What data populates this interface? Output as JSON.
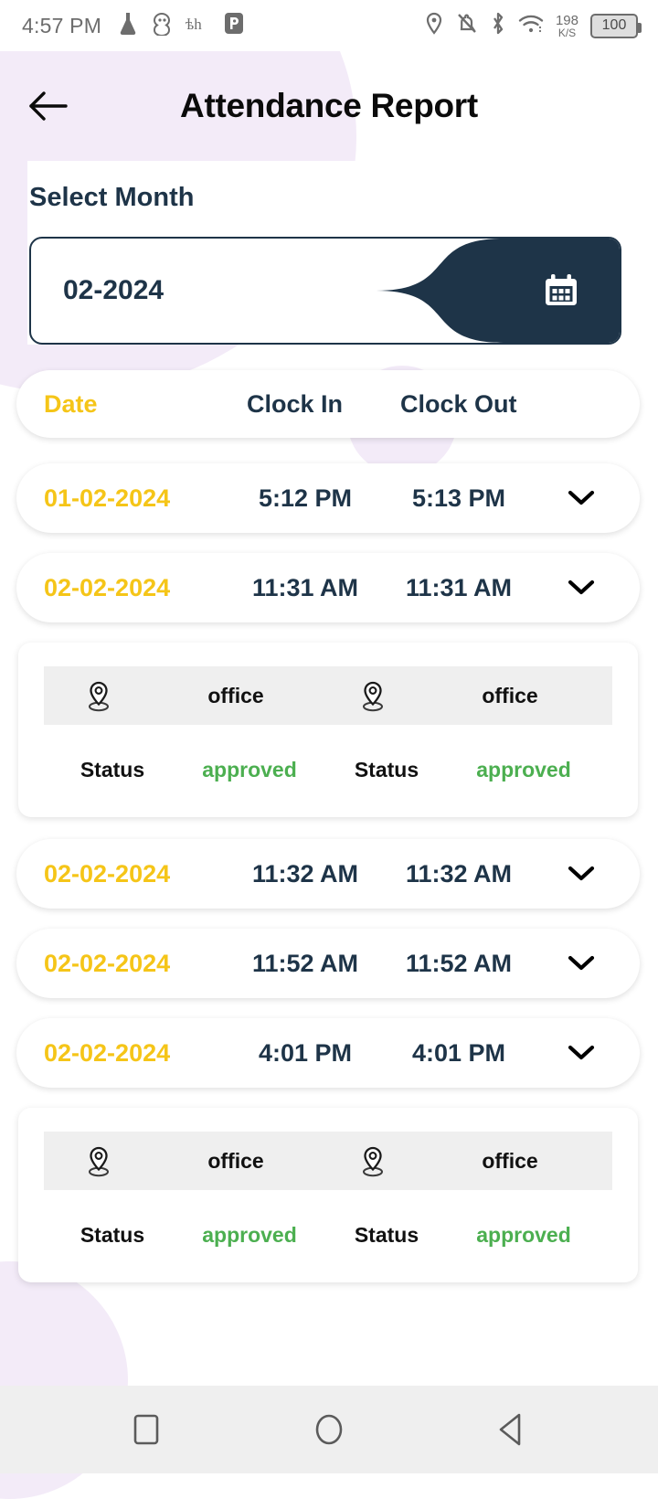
{
  "status_bar": {
    "time": "4:57 PM",
    "left_icons": [
      "flask-icon",
      "app-icon",
      "script-icon",
      "powerpoint-icon"
    ],
    "right_icons": [
      "location-icon",
      "notifications-muted-icon",
      "bluetooth-icon",
      "wifi-icon"
    ],
    "network_speed_value": "198",
    "network_speed_unit": "K/S",
    "battery_level": "100"
  },
  "header": {
    "title": "Attendance Report",
    "back_label": "Back"
  },
  "month_selector": {
    "label": "Select Month",
    "value": "02-2024",
    "icon": "calendar-icon"
  },
  "table": {
    "columns": [
      "Date",
      "Clock In",
      "Clock Out"
    ],
    "rows": [
      {
        "date": "01-02-2024",
        "clock_in": "5:12 PM",
        "clock_out": "5:13 PM",
        "expanded": false
      },
      {
        "date": "02-02-2024",
        "clock_in": "11:31 AM",
        "clock_out": "11:31 AM",
        "expanded": true,
        "detail": {
          "in_location": "office",
          "out_location": "office",
          "in_status_label": "Status",
          "in_status_value": "approved",
          "out_status_label": "Status",
          "out_status_value": "approved"
        }
      },
      {
        "date": "02-02-2024",
        "clock_in": "11:32 AM",
        "clock_out": "11:32 AM",
        "expanded": false
      },
      {
        "date": "02-02-2024",
        "clock_in": "11:52 AM",
        "clock_out": "11:52 AM",
        "expanded": false
      },
      {
        "date": "02-02-2024",
        "clock_in": "4:01 PM",
        "clock_out": "4:01 PM",
        "expanded": true,
        "detail": {
          "in_location": "office",
          "out_location": "office",
          "in_status_label": "Status",
          "in_status_value": "approved",
          "out_status_label": "Status",
          "out_status_value": "approved"
        }
      }
    ]
  },
  "nav_bar": {
    "recents_label": "Recents",
    "home_label": "Home",
    "back_label": "Back"
  },
  "colors": {
    "accent_yellow": "#f5c518",
    "navy": "#1e3448",
    "approved_green": "#4caf50",
    "lavender": "#f3ebf8",
    "band_gray": "#efefef"
  }
}
